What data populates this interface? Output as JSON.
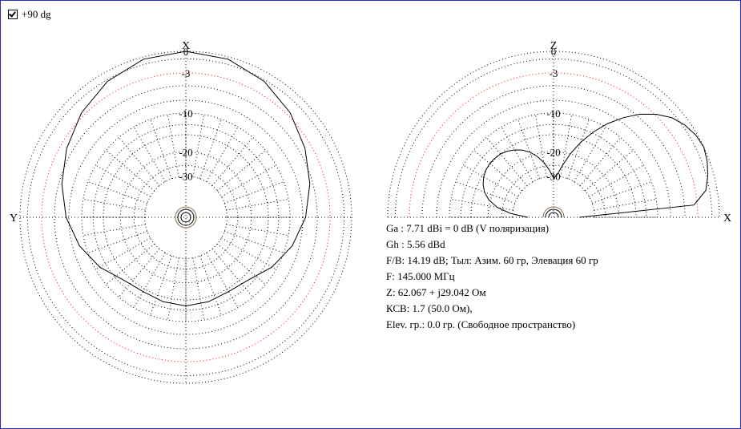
{
  "toggle": {
    "label": "+90 dg",
    "checked": true
  },
  "chart_data": [
    {
      "type": "polar",
      "name": "azimuth",
      "axis_top": "X",
      "axis_left": "Y",
      "ring_labels": [
        "0",
        "-3",
        "-10",
        "-20",
        "-30"
      ],
      "ring_db": [
        0,
        -3,
        -10,
        -20,
        -30
      ],
      "angle_deg": [
        0,
        15,
        30,
        45,
        60,
        75,
        90,
        105,
        120,
        135,
        150,
        165,
        180,
        195,
        210,
        225,
        240,
        255,
        270,
        285,
        300,
        315,
        330,
        345,
        360
      ],
      "gain_db": [
        0,
        -0.3,
        -1.2,
        -2.5,
        -4.0,
        -5.5,
        -7.0,
        -8.8,
        -11.0,
        -13.5,
        -14.2,
        -13.8,
        -13.5,
        -13.8,
        -14.2,
        -13.5,
        -11.0,
        -8.8,
        -7.0,
        -5.5,
        -4.0,
        -2.5,
        -1.2,
        -0.3,
        0
      ],
      "colors": {
        "pattern": "#000000",
        "grid": "#000000",
        "minus3_ring": "#ff0000",
        "inner_rings": "#8a6a4a"
      }
    },
    {
      "type": "polar-half",
      "name": "elevation",
      "axis_top": "Z",
      "axis_right": "X",
      "ring_labels": [
        "0",
        "-3",
        "-10",
        "-20",
        "-30"
      ],
      "ring_db": [
        0,
        -3,
        -10,
        -20,
        -30
      ],
      "angle_deg": [
        0,
        5,
        10,
        15,
        20,
        25,
        30,
        35,
        40,
        45,
        50,
        55,
        60,
        65,
        70,
        75,
        80,
        85,
        90,
        95,
        100,
        105,
        110,
        115,
        120,
        125,
        130,
        135,
        140,
        145,
        150,
        155,
        160,
        165,
        170,
        175,
        180
      ],
      "gain_db": [
        -40,
        -3.5,
        -1.5,
        -0.8,
        -0.3,
        0,
        -0.2,
        -0.7,
        -1.5,
        -2.8,
        -4.5,
        -6.7,
        -9.2,
        -12.2,
        -15.7,
        -19.8,
        -24.5,
        -29.0,
        -31.0,
        -27.0,
        -23.5,
        -20.8,
        -18.8,
        -17.3,
        -16.3,
        -15.5,
        -15.0,
        -14.8,
        -14.8,
        -15.0,
        -15.5,
        -16.3,
        -17.5,
        -19.5,
        -23.0,
        -29.0,
        -40
      ],
      "colors": {
        "pattern": "#000000",
        "grid": "#000000",
        "minus3_ring": "#ff0000",
        "inner_rings": "#8a6a4a"
      }
    }
  ],
  "info_lines": [
    "Ga : 7.71 dBi = 0 dB  (V поляризация)",
    "Gh : 5.56 dBd",
    "F/B: 14.19 dB; Тыл: Азим. 60 гр, Элевация 60 гр",
    "F: 145.000 МГц",
    "Z: 62.067 + j29.042 Ом",
    "КСВ: 1.7 (50.0 Ом),",
    "Elev. гр.: 0.0 гр. (Свободное пространство)"
  ]
}
